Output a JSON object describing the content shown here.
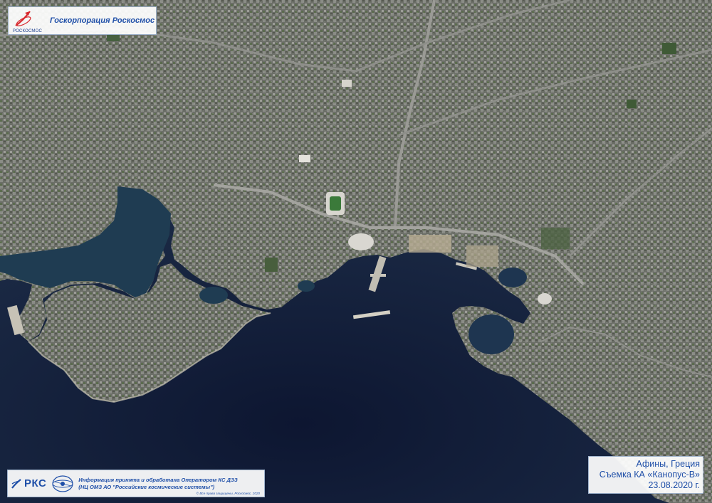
{
  "header": {
    "logo_subtext": "РОСКОСМОС",
    "agency_name": "Госкорпорация Роскосмос"
  },
  "footer": {
    "rks_label": "РКС",
    "info_line1": "Информация принята и обработана Оператором КС ДЗЗ",
    "info_line2": "(НЦ ОМЗ АО \"Российские космические системы\")",
    "copyright": "© Все права защищены, Роскосмос, 2020"
  },
  "caption": {
    "location": "Афины, Греция",
    "satellite": "Съемка КА «Канопус-В»",
    "date": "23.08.2020 г."
  },
  "colors": {
    "brand_blue": "#1f4fa8",
    "logo_red": "#d7262b",
    "sea": "#101a34",
    "harbor_water": "#1f3c52",
    "urban": "#6f726b"
  }
}
